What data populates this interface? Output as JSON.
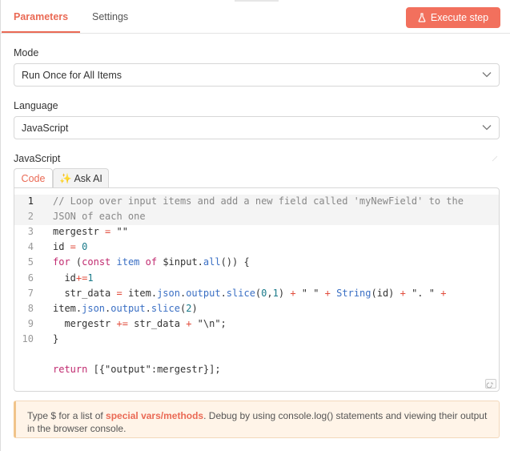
{
  "header": {
    "tabs": [
      {
        "label": "Parameters",
        "active": true
      },
      {
        "label": "Settings",
        "active": false
      }
    ],
    "execute_label": "Execute step",
    "accent_color": "#ea6a55"
  },
  "mode": {
    "label": "Mode",
    "value": "Run Once for All Items"
  },
  "language": {
    "label": "Language",
    "value": "JavaScript"
  },
  "editor": {
    "label": "JavaScript",
    "tabs": [
      {
        "label": "Code",
        "active": true
      },
      {
        "label": "✨ Ask AI",
        "active": false
      }
    ],
    "line_numbers": [
      "1",
      "2",
      "3",
      "4",
      "5",
      "6",
      "7",
      "8",
      "9",
      "10"
    ],
    "active_line": "1",
    "lines": {
      "l1a": "// Loop over input items and add a new field called 'myNewField' to the",
      "l1b": "JSON of each one",
      "l3_var": "mergestr",
      "l3_op": " = ",
      "l3_val": "\"\"",
      "l4_var": "id",
      "l4_op": " = ",
      "l4_val": "0",
      "l5_for": "for",
      "l5_a": " (",
      "l5_const": "const",
      "l5_b": " ",
      "l5_item": "item",
      "l5_c": " ",
      "l5_of": "of",
      "l5_d": " $input.",
      "l5_all": "all",
      "l5_e": "()) {",
      "l6_id": "  id",
      "l6_op": "+=",
      "l6_num": "1",
      "l7_a": "  str_data",
      "l7_op1": " = ",
      "l7_b": "item.",
      "l7_json": "json",
      "l7_c": ".",
      "l7_output": "output",
      "l7_d": ".",
      "l7_slice": "slice",
      "l7_e": "(",
      "l7_n0": "0",
      "l7_f": ",",
      "l7_n1": "1",
      "l7_g": ") ",
      "l7_op2": "+",
      "l7_h": " \" \" ",
      "l7_op3": "+",
      "l7_i": " ",
      "l7_string": "String",
      "l7_j": "(id) ",
      "l7_op4": "+",
      "l7_k": " \". \" ",
      "l7_op5": "+",
      "l8_a": "item.",
      "l8_json": "json",
      "l8_b": ".",
      "l8_output": "output",
      "l8_c": ".",
      "l8_slice": "slice",
      "l8_d": "(",
      "l8_n2": "2",
      "l8_e": ")",
      "l9_a": "  mergestr ",
      "l9_op1": "+=",
      "l9_b": " str_data ",
      "l9_op2": "+",
      "l9_c": " \"\\n\";",
      "l10": "}",
      "ret_kw": "return",
      "ret_a": " [{\"",
      "ret_key": "output",
      "ret_b": "\":mergestr}];"
    }
  },
  "hint": {
    "prefix": "Type $ for a list of ",
    "link": "special vars/methods",
    "suffix": ". Debug by using console.log() statements and viewing their output in the browser console."
  },
  "icons": {
    "execute": "flask-icon",
    "chevron": "chevron-down-icon",
    "resize": "resize-icon"
  }
}
